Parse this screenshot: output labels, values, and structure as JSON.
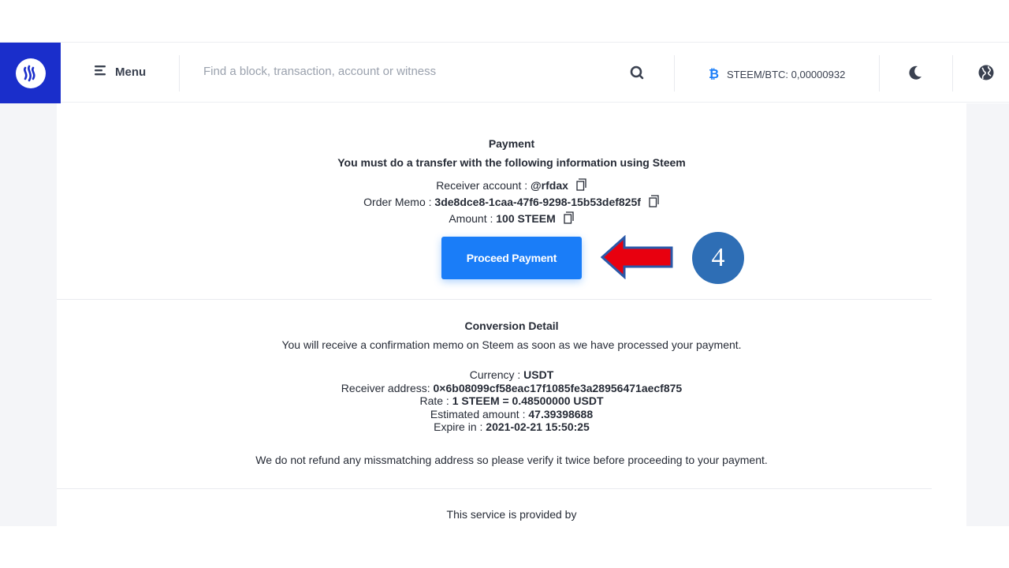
{
  "header": {
    "menu_label": "Menu",
    "search_placeholder": "Find a block, transaction, account or witness",
    "price_label": "STEEM/BTC: 0,00000932",
    "icons": [
      "steem-logo-icon",
      "menu-lines-icon",
      "search-icon",
      "bitcoin-icon",
      "moon-icon",
      "globe-icon"
    ]
  },
  "payment": {
    "title": "Payment",
    "instruction": "You must do a transfer with the following information using Steem",
    "receiver_label": "Receiver account : ",
    "receiver_value": "@rfdax",
    "memo_label": "Order Memo : ",
    "memo_value": "3de8dce8-1caa-47f6-9298-15b53def825f",
    "amount_label": "Amount : ",
    "amount_value": "100 STEEM",
    "button_label": "Proceed Payment"
  },
  "annotation": {
    "step_number": "4",
    "arrow_color": "#e8000f",
    "circle_color": "#2e6eb5"
  },
  "conversion": {
    "title": "Conversion Detail",
    "note": "You will receive a confirmation memo on Steem as soon as we have processed your payment.",
    "currency_label": "Currency : ",
    "currency_value": "USDT",
    "address_label": "Receiver address: ",
    "address_value": "0×6b08099cf58eac17f1085fe3a28956471aecf875",
    "rate_label": "Rate : ",
    "rate_value": "1 STEEM = 0.48500000 USDT",
    "estimated_label": "Estimated amount : ",
    "estimated_value": "47.39398688",
    "expire_label": "Expire in : ",
    "expire_value": "2021-02-21 15:50:25",
    "warning": "We do not refund any missmatching address so please verify it twice before proceeding to your payment."
  },
  "footer": {
    "provided_by": "This service is provided by"
  },
  "colors": {
    "brand_blue": "#1a2ecb",
    "button_blue": "#1a7df8"
  }
}
